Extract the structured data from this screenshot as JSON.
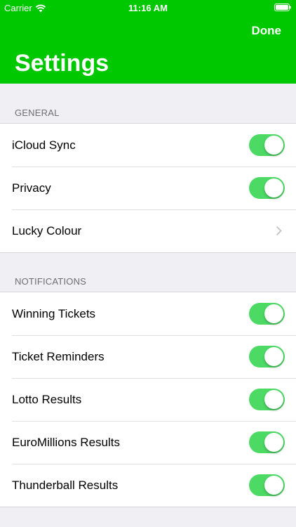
{
  "status_bar": {
    "carrier": "Carrier",
    "time": "11:16 AM"
  },
  "nav": {
    "done_label": "Done",
    "title": "Settings"
  },
  "sections": {
    "general": {
      "header": "GENERAL",
      "rows": [
        {
          "label": "iCloud Sync",
          "control": "toggle",
          "on": true
        },
        {
          "label": "Privacy",
          "control": "toggle",
          "on": true
        },
        {
          "label": "Lucky Colour",
          "control": "disclosure"
        }
      ]
    },
    "notifications": {
      "header": "NOTIFICATIONS",
      "rows": [
        {
          "label": "Winning Tickets",
          "control": "toggle",
          "on": true
        },
        {
          "label": "Ticket Reminders",
          "control": "toggle",
          "on": true
        },
        {
          "label": "Lotto Results",
          "control": "toggle",
          "on": true
        },
        {
          "label": "EuroMillions Results",
          "control": "toggle",
          "on": true
        },
        {
          "label": "Thunderball Results",
          "control": "toggle",
          "on": true
        }
      ]
    }
  },
  "colors": {
    "header_green": "#00c800",
    "toggle_on": "#4cd964",
    "background": "#efeff4"
  },
  "icons": [
    "wifi-icon",
    "battery-icon",
    "chevron-right-icon"
  ]
}
